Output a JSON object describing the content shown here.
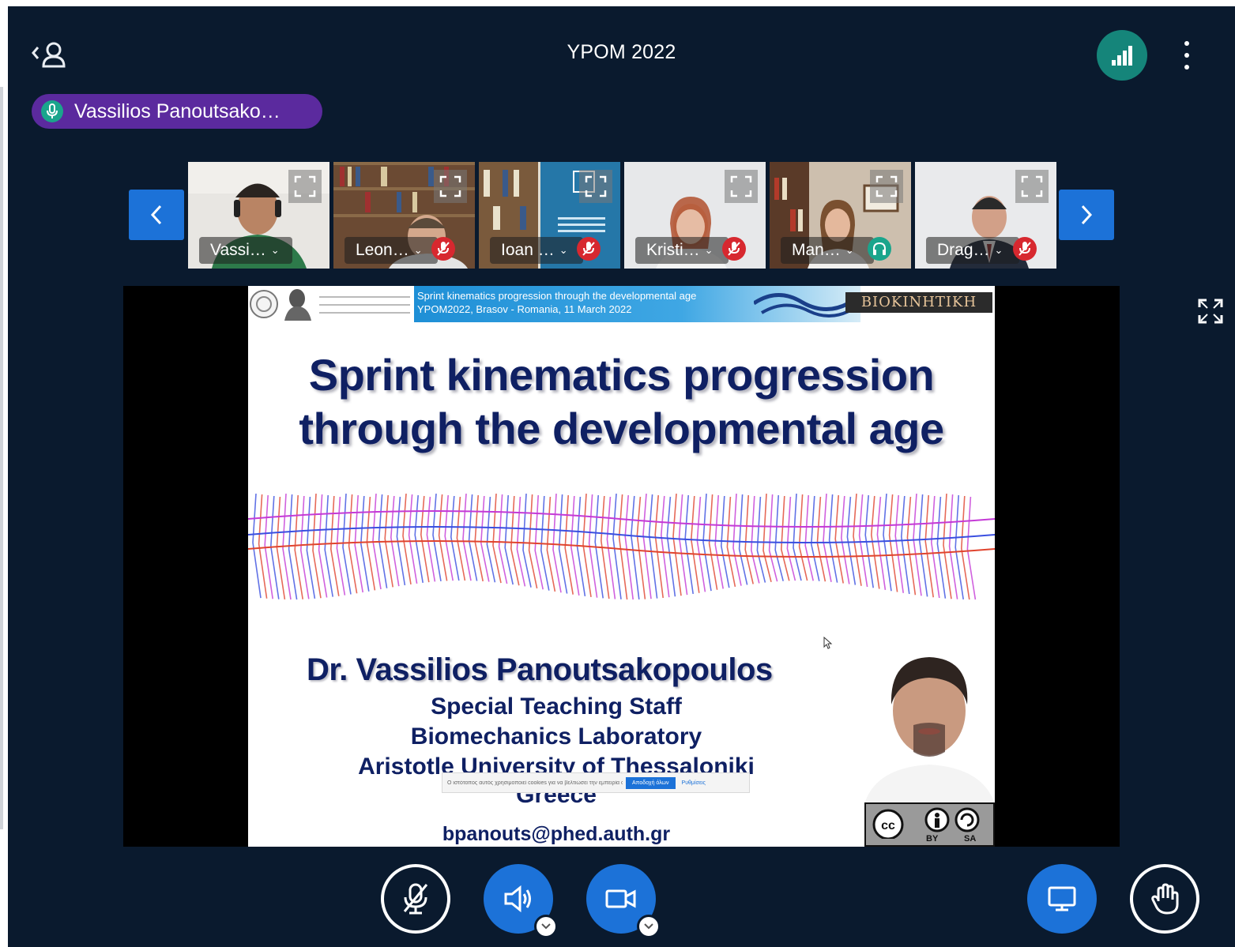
{
  "header": {
    "title": "YPOM 2022",
    "users_toggle_icon": "users-icon",
    "connection_icon": "signal-bars-icon",
    "more_icon": "more-vertical-icon"
  },
  "talking_indicator": {
    "name": "Vassilios Panoutsako…",
    "icon": "microphone-icon",
    "color": "#5b2a9e"
  },
  "video_strip": {
    "prev_icon": "chevron-left-icon",
    "next_icon": "chevron-right-icon",
    "tiles": [
      {
        "label": "Vassi…",
        "status": "talking",
        "active": true
      },
      {
        "label": "Leon…",
        "status": "muted"
      },
      {
        "label": "Ioan …",
        "status": "muted"
      },
      {
        "label": "Kristi…",
        "status": "muted"
      },
      {
        "label": "Man…",
        "status": "listen-only"
      },
      {
        "label": "Drag…",
        "status": "muted"
      }
    ]
  },
  "presentation": {
    "banner_text": "Sprint kinematics progression through the developmental age\nYPOM2022, Brasov - Romania, 11 March 2022",
    "banner_logo_text": "BIOKINHTIKH",
    "title_line1": "Sprint kinematics progression",
    "title_line2": "through the developmental age",
    "author": "Dr. Vassilios Panoutsakopoulos",
    "line1": "Special Teaching Staff",
    "line2": "Biomechanics Laboratory",
    "line3": "Aristotle University of Thessaloniki",
    "line4": "Greece",
    "email": "bpanouts@phed.auth.gr",
    "license_by": "BY",
    "license_sa": "SA",
    "license_cc": "cc",
    "cookie": {
      "text": "Ο ιστότοπος αυτός χρησιμοποιεί cookies για να βελτιώσει την εμπειρία σας",
      "accept": "Αποδοχή όλων",
      "more": "Ρυθμίσεις"
    }
  },
  "controls": {
    "mic": {
      "icon": "microphone-off-icon",
      "state": "muted"
    },
    "audio": {
      "icon": "speaker-icon",
      "state": "joined"
    },
    "camera": {
      "icon": "video-camera-icon",
      "state": "on"
    },
    "screen_share": {
      "icon": "monitor-icon",
      "state": "presenter"
    },
    "raise_hand": {
      "icon": "hand-icon",
      "state": "off"
    }
  },
  "colors": {
    "background": "#0a1a2e",
    "accent_blue": "#1c72d8",
    "connection_green": "#15857a",
    "mute_red": "#d7282f",
    "listen_green": "#1aa58c",
    "slide_title": "#0f2063"
  }
}
